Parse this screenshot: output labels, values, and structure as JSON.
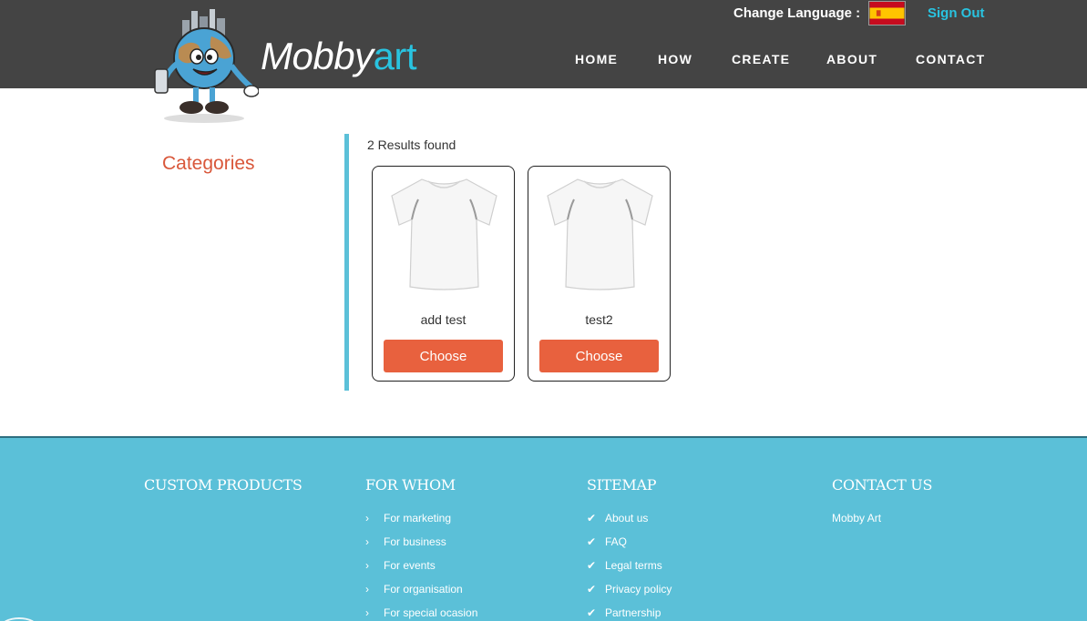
{
  "header": {
    "brand_main": "Mobby",
    "brand_accent": "art",
    "change_language_label": "Change Language :",
    "flag_icon": "spain-flag-icon",
    "sign_out": "Sign Out",
    "nav": [
      "HOME",
      "HOW",
      "CREATE",
      "ABOUT",
      "CONTACT"
    ]
  },
  "sidebar": {
    "title": "Categories"
  },
  "results": {
    "count_text": "2 Results found",
    "products": [
      {
        "name": "add test",
        "button": "Choose",
        "image": "white-tshirt"
      },
      {
        "name": "test2",
        "button": "Choose",
        "image": "white-tshirt"
      }
    ]
  },
  "footer": {
    "custom_products": {
      "title": "CUSTOM PRODUCTS"
    },
    "for_whom": {
      "title": "FOR WHOM",
      "items": [
        "For marketing",
        "For business",
        "For events",
        "For organisation",
        "For special ocasion"
      ]
    },
    "sitemap": {
      "title": "SITEMAP",
      "items": [
        "About us",
        "FAQ",
        "Legal terms",
        "Privacy policy",
        "Partnership"
      ]
    },
    "contact": {
      "title": "CONTACT US",
      "company": "Mobby Art"
    }
  },
  "colors": {
    "header_bg": "#444444",
    "accent_cyan": "#29c3e0",
    "button_orange": "#e8613e",
    "categories_red": "#d9573a",
    "footer_bg": "#5bc0d8"
  }
}
